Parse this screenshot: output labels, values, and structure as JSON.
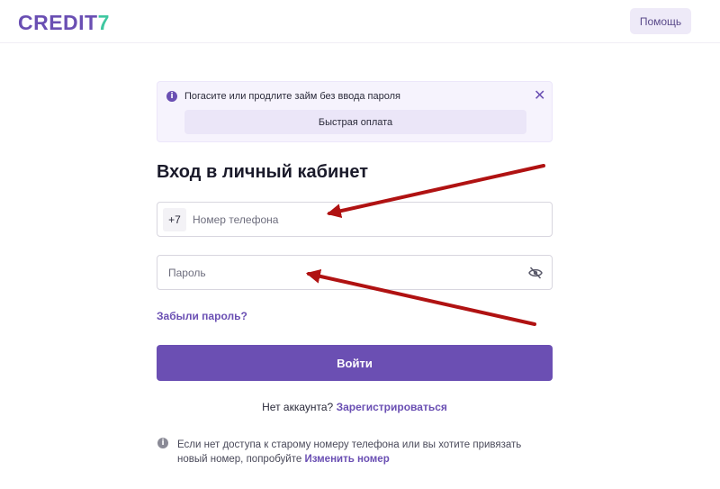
{
  "header": {
    "logo_main": "CREDIT",
    "logo_accent": "7",
    "help_label": "Помощь"
  },
  "notice": {
    "text": "Погасите или продлите займ без ввода пароля",
    "info_icon": "i",
    "close_icon": "✕",
    "quick_pay_label": "Быстрая оплата"
  },
  "form": {
    "title": "Вход в личный кабинет",
    "phone_prefix": "+7",
    "phone_placeholder": "Номер телефона",
    "password_placeholder": "Пароль",
    "forgot_label": "Забыли пароль?",
    "login_label": "Войти"
  },
  "register": {
    "text": "Нет аккаунта?",
    "link_label": "Зарегистрироваться"
  },
  "bottom_info": {
    "icon": "i",
    "text": "Если нет доступа к старому номеру телефона или вы хотите привязать новый номер, попробуйте",
    "link_label": "Изменить номер"
  },
  "colors": {
    "brand": "#6a4fb3",
    "accent": "#3fc7a0",
    "annotation_arrow": "#b01212"
  },
  "icons": {
    "password_toggle": "eye-slash-icon"
  }
}
